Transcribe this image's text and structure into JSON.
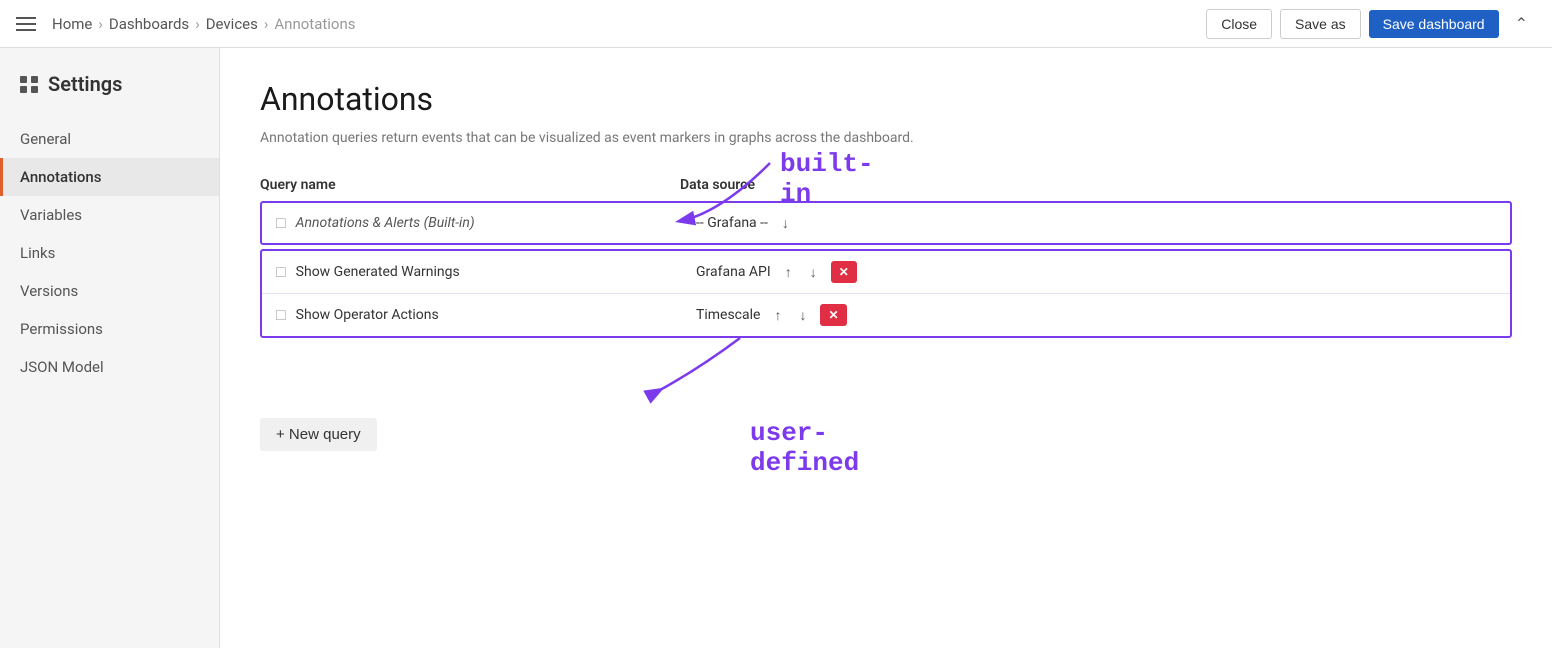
{
  "topbar": {
    "breadcrumbs": [
      "Home",
      "Dashboards",
      "Devices",
      "Annotations"
    ],
    "close_label": "Close",
    "saveas_label": "Save as",
    "savedash_label": "Save dashboard"
  },
  "sidebar": {
    "title": "Settings",
    "nav_items": [
      {
        "id": "general",
        "label": "General",
        "active": false
      },
      {
        "id": "annotations",
        "label": "Annotations",
        "active": true
      },
      {
        "id": "variables",
        "label": "Variables",
        "active": false
      },
      {
        "id": "links",
        "label": "Links",
        "active": false
      },
      {
        "id": "versions",
        "label": "Versions",
        "active": false
      },
      {
        "id": "permissions",
        "label": "Permissions",
        "active": false
      },
      {
        "id": "json-model",
        "label": "JSON Model",
        "active": false
      }
    ]
  },
  "main": {
    "page_title": "Annotations",
    "page_desc": "Annotation queries return events that can be visualized as event markers in graphs across the dashboard.",
    "col_name_header": "Query name",
    "col_source_header": "Data source",
    "builtin_row": {
      "name": "Annotations & Alerts (Built-in)",
      "datasource": "-- Grafana --",
      "italic": true
    },
    "user_rows": [
      {
        "name": "Show Generated Warnings",
        "datasource": "Grafana API"
      },
      {
        "name": "Show Operator Actions",
        "datasource": "Timescale"
      }
    ],
    "new_query_label": "+ New query",
    "builtin_callout": "built-in",
    "userdefined_callout": "user-defined"
  }
}
